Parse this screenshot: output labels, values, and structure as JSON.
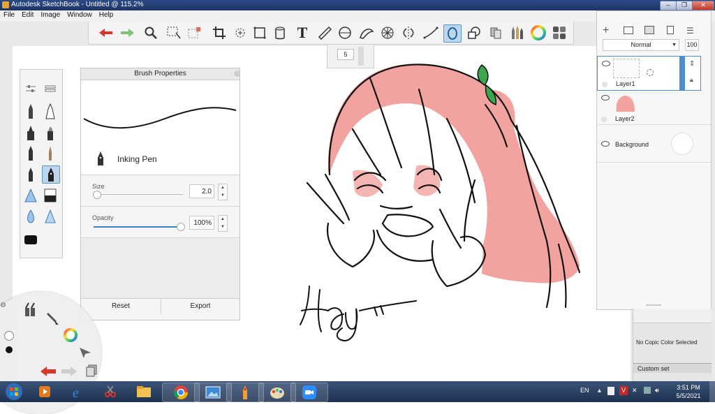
{
  "window": {
    "title": "Autodesk SketchBook - Untitled @ 115.2%"
  },
  "menu": [
    "File",
    "Edit",
    "Image",
    "Window",
    "Help"
  ],
  "toolbar": {
    "items": [
      "undo-icon",
      "redo-icon",
      "zoom-icon",
      "select-icon",
      "transform-select-icon",
      "crop-icon",
      "lasso-icon",
      "distort-icon",
      "fill-icon",
      "text-icon",
      "ruler-icon",
      "ellipse-guide-icon",
      "french-curve-icon",
      "perspective-icon",
      "symmetry-icon",
      "stroke-icon",
      "ellipse-icon",
      "shape-icon",
      "copic-icon",
      "brush-library-icon",
      "color-wheel-icon",
      "panels-icon"
    ],
    "selected": "ellipse-icon"
  },
  "brush_size_puck": {
    "value": "5"
  },
  "tool_palette": {
    "selected": "inking-pen"
  },
  "brush_properties": {
    "title": "Brush Properties",
    "brush_name": "Inking Pen",
    "size_label": "Size",
    "size_value": "2.0",
    "size_fraction": 0.0,
    "opacity_label": "Opacity",
    "opacity_value": "100%",
    "opacity_fraction": 1.0,
    "reset_label": "Reset",
    "export_label": "Export"
  },
  "layers": {
    "blend_mode": "Normal",
    "opacity": "100",
    "rows": [
      {
        "name": "Layer1",
        "selected": true
      },
      {
        "name": "Layer2",
        "selected": false
      },
      {
        "name": "Background",
        "selected": false
      }
    ]
  },
  "copic": {
    "status": "No Copic Color Selected",
    "custom_set": "Custom set"
  },
  "canvas": {
    "signature": "Hay"
  },
  "taskbar": {
    "language": "EN",
    "time": "3:51 PM",
    "date": "5/5/2021"
  },
  "colors": {
    "hair": "#f2a39f",
    "accent_blue": "#5f96c8",
    "ribbon": "#3aa84a"
  }
}
